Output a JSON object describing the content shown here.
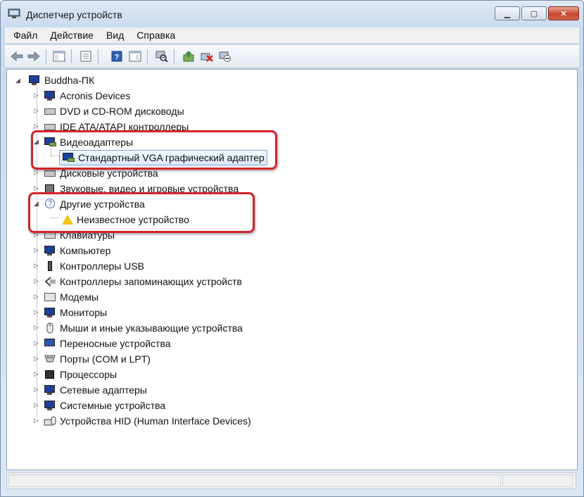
{
  "window": {
    "title": "Диспетчер устройств"
  },
  "menu": [
    {
      "label": "Файл"
    },
    {
      "label": "Действие"
    },
    {
      "label": "Вид"
    },
    {
      "label": "Справка"
    }
  ],
  "toolbar": {
    "buttons": [
      "back-icon",
      "forward-icon",
      "console-tree-icon",
      "properties-icon",
      "help-icon",
      "action-pane-icon",
      "scan-hardware-icon",
      "update-driver-icon",
      "uninstall-icon",
      "disable-icon"
    ]
  },
  "tree": {
    "root": "Buddha-ПК",
    "items": [
      {
        "label": "Acronis Devices"
      },
      {
        "label": "DVD и CD-ROM дисководы"
      },
      {
        "label": "IDE ATA/ATAPI контроллеры"
      },
      {
        "label": "Видеоадаптеры",
        "children": [
          {
            "label": "Стандартный VGA графический адаптер"
          }
        ]
      },
      {
        "label": "Дисковые устройства"
      },
      {
        "label": "Звуковые, видео и игровые устройства"
      },
      {
        "label": "Другие устройства",
        "children": [
          {
            "label": "Неизвестное устройство"
          }
        ]
      },
      {
        "label": "Клавиатуры"
      },
      {
        "label": "Компьютер"
      },
      {
        "label": "Контроллеры USB"
      },
      {
        "label": "Контроллеры запоминающих устройств"
      },
      {
        "label": "Модемы"
      },
      {
        "label": "Мониторы"
      },
      {
        "label": "Мыши и иные указывающие устройства"
      },
      {
        "label": "Переносные устройства"
      },
      {
        "label": "Порты (COM и LPT)"
      },
      {
        "label": "Процессоры"
      },
      {
        "label": "Сетевые адаптеры"
      },
      {
        "label": "Системные устройства"
      },
      {
        "label": "Устройства HID (Human Interface Devices)"
      }
    ]
  },
  "colors": {
    "highlight": "#d2232a",
    "selection": "#dbe9fa"
  }
}
